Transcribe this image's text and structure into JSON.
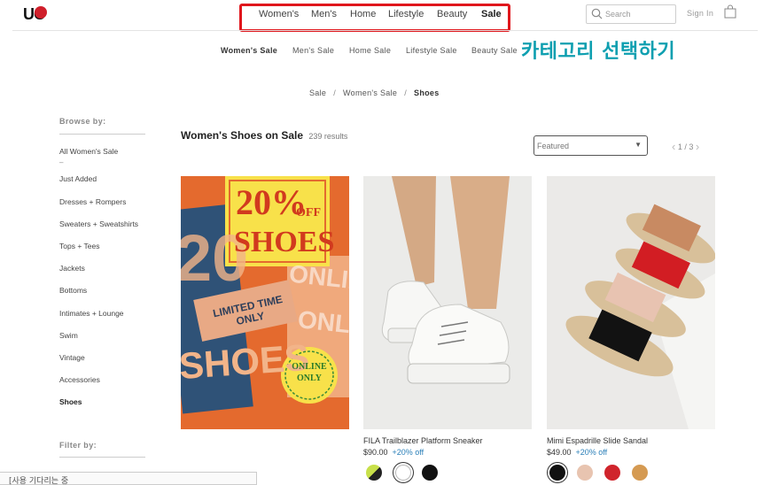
{
  "brand": {
    "logo_text": "UO"
  },
  "main_nav": [
    {
      "label": "Women's"
    },
    {
      "label": "Men's"
    },
    {
      "label": "Home"
    },
    {
      "label": "Lifestyle"
    },
    {
      "label": "Beauty"
    },
    {
      "label": "Sale",
      "active": true
    }
  ],
  "header": {
    "search_placeholder": "Search",
    "signin_label": "Sign In",
    "bag_icon": "shopping-bag-icon"
  },
  "sub_nav": [
    {
      "label": "Women's Sale",
      "active": true
    },
    {
      "label": "Men's Sale"
    },
    {
      "label": "Home Sale"
    },
    {
      "label": "Lifestyle Sale"
    },
    {
      "label": "Beauty Sale"
    }
  ],
  "annotation": {
    "text": "카테고리 선택하기",
    "color": "#0e9fb0"
  },
  "breadcrumb": [
    "Sale",
    "Women's Sale",
    "Shoes"
  ],
  "sidebar": {
    "browse_label": "Browse by:",
    "links": [
      {
        "label": "All Women's Sale"
      },
      {
        "label": "Just Added"
      },
      {
        "label": "Dresses + Rompers"
      },
      {
        "label": "Sweaters + Sweatshirts"
      },
      {
        "label": "Tops + Tees"
      },
      {
        "label": "Jackets"
      },
      {
        "label": "Bottoms"
      },
      {
        "label": "Intimates + Lounge"
      },
      {
        "label": "Swim"
      },
      {
        "label": "Vintage"
      },
      {
        "label": "Accessories"
      },
      {
        "label": "Shoes",
        "active": true
      }
    ],
    "filter_label": "Filter by:"
  },
  "results": {
    "title": "Women's Shoes on Sale",
    "count": "239 results"
  },
  "sort": {
    "selected": "Featured"
  },
  "pager": {
    "text": "1 / 3"
  },
  "promo": {
    "headline_1": "20%",
    "headline_2": "OFF",
    "headline_3": "SHOES",
    "limited": "LIMITED TIME ONLY",
    "bg_text_1": "20",
    "bg_text_2": "SHOES",
    "online_1": "ONLINE",
    "online_2": "ONLY",
    "bg_text_3": "ONLINE",
    "bg_text_4": "ONLY"
  },
  "products": [
    {
      "name": "FILA Trailblazer Platform Sneaker",
      "price": "$90.00",
      "discount": "+20% off",
      "swatches": [
        "#9bc43a",
        "#ffffff",
        "#111111"
      ]
    },
    {
      "name": "Mimi Espadrille Slide Sandal",
      "price": "$49.00",
      "discount": "+20% off",
      "swatches": [
        "#111111",
        "#e8c4b0",
        "#d0242c",
        "#d59a52"
      ]
    }
  ],
  "status": {
    "text": "[사용 기다리는 중"
  },
  "colors": {
    "accent": "#e0161c",
    "discount": "#2a7fb8"
  }
}
